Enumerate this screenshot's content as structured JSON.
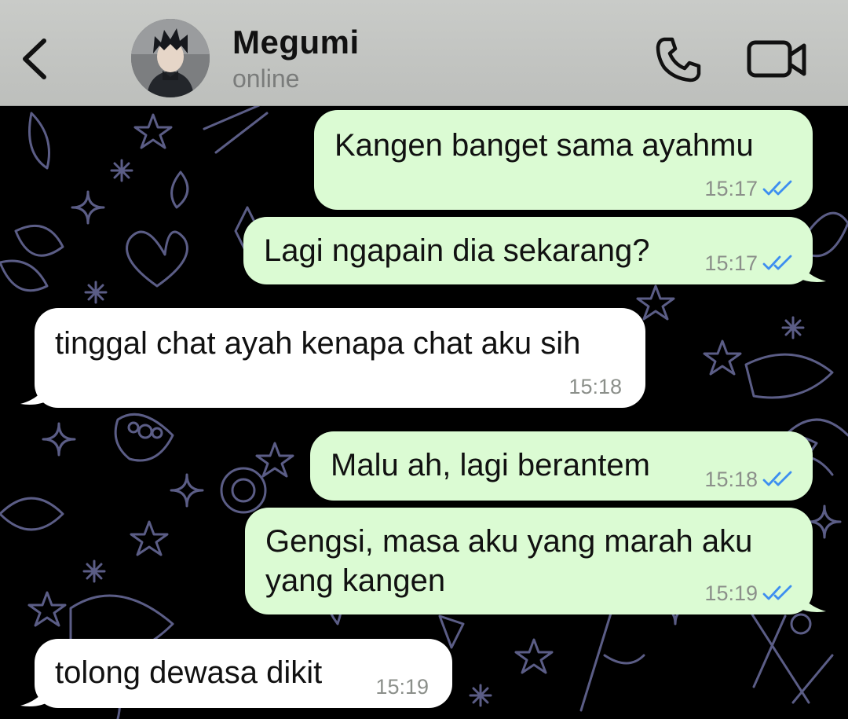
{
  "header": {
    "back_icon": "chevron-left-icon",
    "contact_name": "Megumi",
    "status": "online",
    "call_icon": "phone-icon",
    "video_icon": "video-camera-icon"
  },
  "colors": {
    "header_bg": "#c9cbc8",
    "chat_bg": "#000000",
    "outgoing_bubble": "#dbfbd3",
    "incoming_bubble": "#ffffff",
    "read_ticks": "#3d8ef0",
    "doodle_stroke": "#5b5d86"
  },
  "messages": [
    {
      "direction": "out",
      "text": "Kangen banget sama ayahmu",
      "time": "15:17",
      "status": "read"
    },
    {
      "direction": "out",
      "text": "Lagi ngapain dia sekarang?",
      "time": "15:17",
      "status": "read"
    },
    {
      "direction": "in",
      "text": "tinggal chat ayah kenapa chat aku sih",
      "time": "15:18"
    },
    {
      "direction": "out",
      "text": "Malu ah, lagi berantem",
      "time": "15:18",
      "status": "read"
    },
    {
      "direction": "out",
      "text": "Gengsi, masa aku yang marah aku\nyang kangen",
      "time": "15:19",
      "status": "read"
    },
    {
      "direction": "in",
      "text": "tolong dewasa dikit",
      "time": "15:19"
    }
  ]
}
